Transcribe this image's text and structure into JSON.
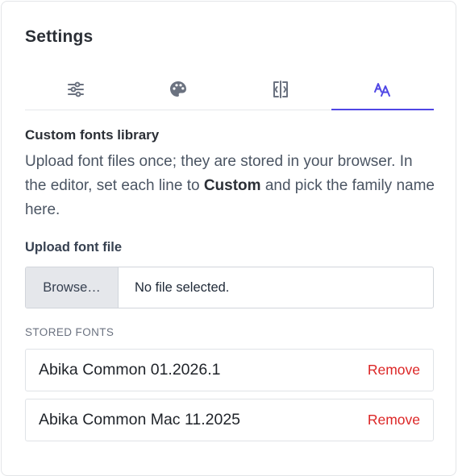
{
  "panel": {
    "title": "Settings"
  },
  "tabs": [
    {
      "icon": "sliders-icon",
      "active": false
    },
    {
      "icon": "palette-icon",
      "active": false
    },
    {
      "icon": "spacing-icon",
      "active": false
    },
    {
      "icon": "font-size-icon",
      "active": true
    }
  ],
  "colors": {
    "accent": "#4f46e5",
    "remove": "#dc2626",
    "inactive_icon": "#6b7280"
  },
  "custom_fonts": {
    "heading": "Custom fonts library",
    "description_part1": "Upload font files once; they are stored in your browser. In the editor, set each line to ",
    "description_bold": "Custom",
    "description_part2": " and pick the family name here."
  },
  "upload": {
    "label": "Upload font file",
    "browse_label": "Browse…",
    "status": "No file selected."
  },
  "stored": {
    "label": "STORED FONTS",
    "fonts": [
      {
        "name": "Abika Common 01.2026.1",
        "remove_label": "Remove"
      },
      {
        "name": "Abika Common Mac 11.2025",
        "remove_label": "Remove"
      }
    ]
  }
}
